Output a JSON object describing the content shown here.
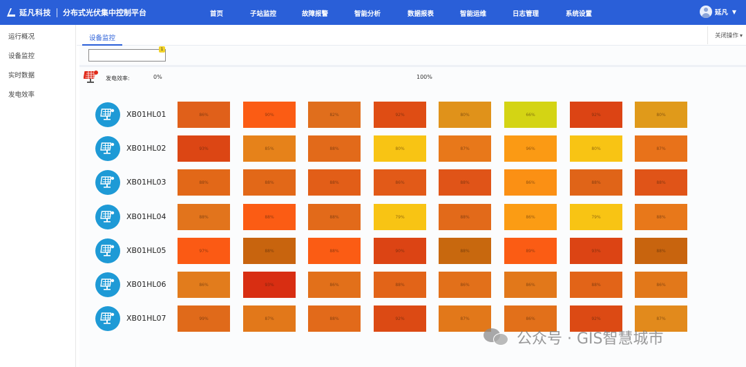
{
  "header": {
    "brand_name": "延凡科技",
    "app_title": "分布式光伏集中控制平台",
    "nav": [
      "首页",
      "子站监控",
      "故障报警",
      "智能分析",
      "数据报表",
      "智能运维",
      "日志管理",
      "系统设置"
    ],
    "user_name": "延凡",
    "user_caret": "▼"
  },
  "sidebar": {
    "items": [
      "运行概况",
      "设备监控",
      "实时数据",
      "发电效率"
    ]
  },
  "tabs": {
    "active": "设备监控",
    "close_ops": "关闭操作",
    "close_caret": "▾"
  },
  "search": {
    "value": "",
    "badge": "1"
  },
  "legend": {
    "label": "发电效率:",
    "min": "0%",
    "max": "100%"
  },
  "grid": {
    "rows": [
      {
        "id": "XB01HL01",
        "cells": [
          {
            "v": "86%",
            "c": "#e0601a"
          },
          {
            "v": "90%",
            "c": "#fb5c14"
          },
          {
            "v": "82%",
            "c": "#e06e1c"
          },
          {
            "v": "92%",
            "c": "#df4d14"
          },
          {
            "v": "80%",
            "c": "#e0921a"
          },
          {
            "v": "66%",
            "c": "#d4d414"
          },
          {
            "v": "92%",
            "c": "#dc4414"
          },
          {
            "v": "80%",
            "c": "#e09a1a"
          }
        ]
      },
      {
        "id": "XB01HL02",
        "cells": [
          {
            "v": "93%",
            "c": "#dc4614"
          },
          {
            "v": "85%",
            "c": "#e6821a"
          },
          {
            "v": "88%",
            "c": "#e26a1a"
          },
          {
            "v": "80%",
            "c": "#f8c414"
          },
          {
            "v": "87%",
            "c": "#e8781a"
          },
          {
            "v": "96%",
            "c": "#fb9a14"
          },
          {
            "v": "80%",
            "c": "#f8c414"
          },
          {
            "v": "87%",
            "c": "#e8721a"
          }
        ]
      },
      {
        "id": "XB01HL03",
        "cells": [
          {
            "v": "88%",
            "c": "#e26818"
          },
          {
            "v": "88%",
            "c": "#e26818"
          },
          {
            "v": "88%",
            "c": "#e25e18"
          },
          {
            "v": "86%",
            "c": "#e25a18"
          },
          {
            "v": "88%",
            "c": "#e05418"
          },
          {
            "v": "86%",
            "c": "#fb9014"
          },
          {
            "v": "88%",
            "c": "#e06418"
          },
          {
            "v": "88%",
            "c": "#e05418"
          }
        ]
      },
      {
        "id": "XB01HL04",
        "cells": [
          {
            "v": "88%",
            "c": "#e2741c"
          },
          {
            "v": "88%",
            "c": "#fb5c14"
          },
          {
            "v": "88%",
            "c": "#e26a1a"
          },
          {
            "v": "79%",
            "c": "#f8c414"
          },
          {
            "v": "88%",
            "c": "#e26a1a"
          },
          {
            "v": "86%",
            "c": "#fb9c14"
          },
          {
            "v": "79%",
            "c": "#f8c414"
          },
          {
            "v": "88%",
            "c": "#e8781a"
          }
        ]
      },
      {
        "id": "XB01HL05",
        "cells": [
          {
            "v": "97%",
            "c": "#fb5a14"
          },
          {
            "v": "88%",
            "c": "#c8640e"
          },
          {
            "v": "88%",
            "c": "#fb5c14"
          },
          {
            "v": "90%",
            "c": "#dc4414"
          },
          {
            "v": "88%",
            "c": "#c8680e"
          },
          {
            "v": "89%",
            "c": "#fb5c14"
          },
          {
            "v": "93%",
            "c": "#dc4414"
          },
          {
            "v": "88%",
            "c": "#c8640e"
          }
        ]
      },
      {
        "id": "XB01HL06",
        "cells": [
          {
            "v": "86%",
            "c": "#e27c1c"
          },
          {
            "v": "93%",
            "c": "#d82e12"
          },
          {
            "v": "86%",
            "c": "#e2701a"
          },
          {
            "v": "88%",
            "c": "#e26418"
          },
          {
            "v": "86%",
            "c": "#e2701a"
          },
          {
            "v": "86%",
            "c": "#e2781a"
          },
          {
            "v": "88%",
            "c": "#e26418"
          },
          {
            "v": "86%",
            "c": "#e2781a"
          }
        ]
      },
      {
        "id": "XB01HL07",
        "cells": [
          {
            "v": "99%",
            "c": "#e06a1a"
          },
          {
            "v": "87%",
            "c": "#e2781a"
          },
          {
            "v": "88%",
            "c": "#e26a1a"
          },
          {
            "v": "92%",
            "c": "#dc4a14"
          },
          {
            "v": "87%",
            "c": "#e2781a"
          },
          {
            "v": "86%",
            "c": "#e2701a"
          },
          {
            "v": "92%",
            "c": "#dc4a14"
          },
          {
            "v": "87%",
            "c": "#e28a1c"
          }
        ]
      }
    ]
  },
  "watermark": {
    "text": "公众号 · GIS智慧城市"
  }
}
